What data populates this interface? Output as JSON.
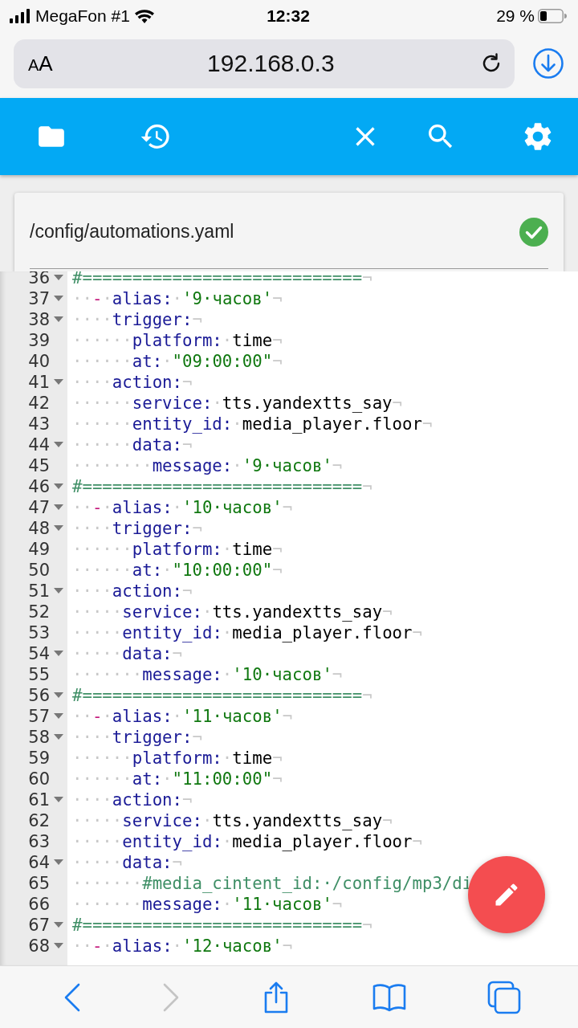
{
  "status_bar": {
    "carrier": "MegaFon #1",
    "time": "12:32",
    "battery": "29 %"
  },
  "address_bar": {
    "text_size_button": "AA",
    "url": "192.168.0.3"
  },
  "file": {
    "path": "/config/automations.yaml",
    "valid": true
  },
  "editor": {
    "lines": [
      {
        "number": "36",
        "fold": true,
        "tokens": [
          {
            "kind": "comment",
            "text": "#============================"
          },
          {
            "kind": "eol",
            "text": "¬"
          }
        ]
      },
      {
        "number": "37",
        "fold": true,
        "tokens": [
          {
            "kind": "ws",
            "text": "··"
          },
          {
            "kind": "dash",
            "text": "-"
          },
          {
            "kind": "ws",
            "text": "·"
          },
          {
            "kind": "key",
            "text": "alias:"
          },
          {
            "kind": "ws",
            "text": "·"
          },
          {
            "kind": "str",
            "text": "'9·часов'"
          },
          {
            "kind": "eol",
            "text": "¬"
          }
        ]
      },
      {
        "number": "38",
        "fold": true,
        "tokens": [
          {
            "kind": "ws",
            "text": "····"
          },
          {
            "kind": "key",
            "text": "trigger:"
          },
          {
            "kind": "eol",
            "text": "¬"
          }
        ]
      },
      {
        "number": "39",
        "fold": false,
        "tokens": [
          {
            "kind": "ws",
            "text": "······"
          },
          {
            "kind": "key",
            "text": "platform:"
          },
          {
            "kind": "ws",
            "text": "·"
          },
          {
            "kind": "plain",
            "text": "time"
          },
          {
            "kind": "eol",
            "text": "¬"
          }
        ]
      },
      {
        "number": "40",
        "fold": false,
        "tokens": [
          {
            "kind": "ws",
            "text": "······"
          },
          {
            "kind": "key",
            "text": "at:"
          },
          {
            "kind": "ws",
            "text": "·"
          },
          {
            "kind": "str",
            "text": "\"09:00:00\""
          },
          {
            "kind": "eol",
            "text": "¬"
          }
        ]
      },
      {
        "number": "41",
        "fold": true,
        "tokens": [
          {
            "kind": "ws",
            "text": "····"
          },
          {
            "kind": "key",
            "text": "action:"
          },
          {
            "kind": "eol",
            "text": "¬"
          }
        ]
      },
      {
        "number": "42",
        "fold": false,
        "tokens": [
          {
            "kind": "ws",
            "text": "······"
          },
          {
            "kind": "key",
            "text": "service:"
          },
          {
            "kind": "ws",
            "text": "·"
          },
          {
            "kind": "plain",
            "text": "tts.yandextts_say"
          },
          {
            "kind": "eol",
            "text": "¬"
          }
        ]
      },
      {
        "number": "43",
        "fold": false,
        "tokens": [
          {
            "kind": "ws",
            "text": "······"
          },
          {
            "kind": "key",
            "text": "entity_id:"
          },
          {
            "kind": "ws",
            "text": "·"
          },
          {
            "kind": "plain",
            "text": "media_player.floor"
          },
          {
            "kind": "eol",
            "text": "¬"
          }
        ]
      },
      {
        "number": "44",
        "fold": true,
        "tokens": [
          {
            "kind": "ws",
            "text": "······"
          },
          {
            "kind": "key",
            "text": "data:"
          },
          {
            "kind": "eol",
            "text": "¬"
          }
        ]
      },
      {
        "number": "45",
        "fold": false,
        "tokens": [
          {
            "kind": "ws",
            "text": "········"
          },
          {
            "kind": "key",
            "text": "message:"
          },
          {
            "kind": "ws",
            "text": "·"
          },
          {
            "kind": "str",
            "text": "'9·часов'"
          },
          {
            "kind": "eol",
            "text": "¬"
          }
        ]
      },
      {
        "number": "46",
        "fold": true,
        "tokens": [
          {
            "kind": "comment",
            "text": "#============================"
          },
          {
            "kind": "eol",
            "text": "¬"
          }
        ]
      },
      {
        "number": "47",
        "fold": true,
        "tokens": [
          {
            "kind": "ws",
            "text": "··"
          },
          {
            "kind": "dash",
            "text": "-"
          },
          {
            "kind": "ws",
            "text": "·"
          },
          {
            "kind": "key",
            "text": "alias:"
          },
          {
            "kind": "ws",
            "text": "·"
          },
          {
            "kind": "str",
            "text": "'10·часов'"
          },
          {
            "kind": "eol",
            "text": "¬"
          }
        ]
      },
      {
        "number": "48",
        "fold": true,
        "tokens": [
          {
            "kind": "ws",
            "text": "····"
          },
          {
            "kind": "key",
            "text": "trigger:"
          },
          {
            "kind": "eol",
            "text": "¬"
          }
        ]
      },
      {
        "number": "49",
        "fold": false,
        "tokens": [
          {
            "kind": "ws",
            "text": "······"
          },
          {
            "kind": "key",
            "text": "platform:"
          },
          {
            "kind": "ws",
            "text": "·"
          },
          {
            "kind": "plain",
            "text": "time"
          },
          {
            "kind": "eol",
            "text": "¬"
          }
        ]
      },
      {
        "number": "50",
        "fold": false,
        "tokens": [
          {
            "kind": "ws",
            "text": "······"
          },
          {
            "kind": "key",
            "text": "at:"
          },
          {
            "kind": "ws",
            "text": "·"
          },
          {
            "kind": "str",
            "text": "\"10:00:00\""
          },
          {
            "kind": "eol",
            "text": "¬"
          }
        ]
      },
      {
        "number": "51",
        "fold": true,
        "tokens": [
          {
            "kind": "ws",
            "text": "····"
          },
          {
            "kind": "key",
            "text": "action:"
          },
          {
            "kind": "eol",
            "text": "¬"
          }
        ]
      },
      {
        "number": "52",
        "fold": false,
        "tokens": [
          {
            "kind": "ws",
            "text": "·····"
          },
          {
            "kind": "key",
            "text": "service:"
          },
          {
            "kind": "ws",
            "text": "·"
          },
          {
            "kind": "plain",
            "text": "tts.yandextts_say"
          },
          {
            "kind": "eol",
            "text": "¬"
          }
        ]
      },
      {
        "number": "53",
        "fold": false,
        "tokens": [
          {
            "kind": "ws",
            "text": "·····"
          },
          {
            "kind": "key",
            "text": "entity_id:"
          },
          {
            "kind": "ws",
            "text": "·"
          },
          {
            "kind": "plain",
            "text": "media_player.floor"
          },
          {
            "kind": "eol",
            "text": "¬"
          }
        ]
      },
      {
        "number": "54",
        "fold": true,
        "tokens": [
          {
            "kind": "ws",
            "text": "·····"
          },
          {
            "kind": "key",
            "text": "data:"
          },
          {
            "kind": "eol",
            "text": "¬"
          }
        ]
      },
      {
        "number": "55",
        "fold": false,
        "tokens": [
          {
            "kind": "ws",
            "text": "·······"
          },
          {
            "kind": "key",
            "text": "message:"
          },
          {
            "kind": "ws",
            "text": "·"
          },
          {
            "kind": "str",
            "text": "'10·часов'"
          },
          {
            "kind": "eol",
            "text": "¬"
          }
        ]
      },
      {
        "number": "56",
        "fold": true,
        "tokens": [
          {
            "kind": "comment",
            "text": "#============================"
          },
          {
            "kind": "eol",
            "text": "¬"
          }
        ]
      },
      {
        "number": "57",
        "fold": true,
        "tokens": [
          {
            "kind": "ws",
            "text": "··"
          },
          {
            "kind": "dash",
            "text": "-"
          },
          {
            "kind": "ws",
            "text": "·"
          },
          {
            "kind": "key",
            "text": "alias:"
          },
          {
            "kind": "ws",
            "text": "·"
          },
          {
            "kind": "str",
            "text": "'11·часов'"
          },
          {
            "kind": "eol",
            "text": "¬"
          }
        ]
      },
      {
        "number": "58",
        "fold": true,
        "tokens": [
          {
            "kind": "ws",
            "text": "····"
          },
          {
            "kind": "key",
            "text": "trigger:"
          },
          {
            "kind": "eol",
            "text": "¬"
          }
        ]
      },
      {
        "number": "59",
        "fold": false,
        "tokens": [
          {
            "kind": "ws",
            "text": "······"
          },
          {
            "kind": "key",
            "text": "platform:"
          },
          {
            "kind": "ws",
            "text": "·"
          },
          {
            "kind": "plain",
            "text": "time"
          },
          {
            "kind": "eol",
            "text": "¬"
          }
        ]
      },
      {
        "number": "60",
        "fold": false,
        "tokens": [
          {
            "kind": "ws",
            "text": "······"
          },
          {
            "kind": "key",
            "text": "at:"
          },
          {
            "kind": "ws",
            "text": "·"
          },
          {
            "kind": "str",
            "text": "\"11:00:00\""
          },
          {
            "kind": "eol",
            "text": "¬"
          }
        ]
      },
      {
        "number": "61",
        "fold": true,
        "tokens": [
          {
            "kind": "ws",
            "text": "····"
          },
          {
            "kind": "key",
            "text": "action:"
          },
          {
            "kind": "eol",
            "text": "¬"
          }
        ]
      },
      {
        "number": "62",
        "fold": false,
        "tokens": [
          {
            "kind": "ws",
            "text": "·····"
          },
          {
            "kind": "key",
            "text": "service:"
          },
          {
            "kind": "ws",
            "text": "·"
          },
          {
            "kind": "plain",
            "text": "tts.yandextts_say"
          },
          {
            "kind": "eol",
            "text": "¬"
          }
        ]
      },
      {
        "number": "63",
        "fold": false,
        "tokens": [
          {
            "kind": "ws",
            "text": "·····"
          },
          {
            "kind": "key",
            "text": "entity_id:"
          },
          {
            "kind": "ws",
            "text": "·"
          },
          {
            "kind": "plain",
            "text": "media_player.floor"
          },
          {
            "kind": "eol",
            "text": "¬"
          }
        ]
      },
      {
        "number": "64",
        "fold": true,
        "tokens": [
          {
            "kind": "ws",
            "text": "·····"
          },
          {
            "kind": "key",
            "text": "data:"
          },
          {
            "kind": "eol",
            "text": "¬"
          }
        ]
      },
      {
        "number": "65",
        "fold": false,
        "tokens": [
          {
            "kind": "ws",
            "text": "·······"
          },
          {
            "kind": "comment",
            "text": "#media_cintent_id:·/config/mp3/di"
          }
        ]
      },
      {
        "number": "66",
        "fold": false,
        "tokens": [
          {
            "kind": "ws",
            "text": "·······"
          },
          {
            "kind": "key",
            "text": "message:"
          },
          {
            "kind": "ws",
            "text": "·"
          },
          {
            "kind": "str",
            "text": "'11·часов'"
          },
          {
            "kind": "eol",
            "text": "¬"
          }
        ]
      },
      {
        "number": "67",
        "fold": true,
        "tokens": [
          {
            "kind": "comment",
            "text": "#============================"
          },
          {
            "kind": "eol",
            "text": "¬"
          }
        ]
      },
      {
        "number": "68",
        "fold": true,
        "tokens": [
          {
            "kind": "ws",
            "text": "··"
          },
          {
            "kind": "dash",
            "text": "-"
          },
          {
            "kind": "ws",
            "text": "·"
          },
          {
            "kind": "key",
            "text": "alias:"
          },
          {
            "kind": "ws",
            "text": "·"
          },
          {
            "kind": "str",
            "text": "'12·часов'"
          },
          {
            "kind": "eol",
            "text": "¬"
          }
        ]
      }
    ]
  },
  "browser_nav": {
    "back_disabled": false,
    "forward_disabled": true
  }
}
